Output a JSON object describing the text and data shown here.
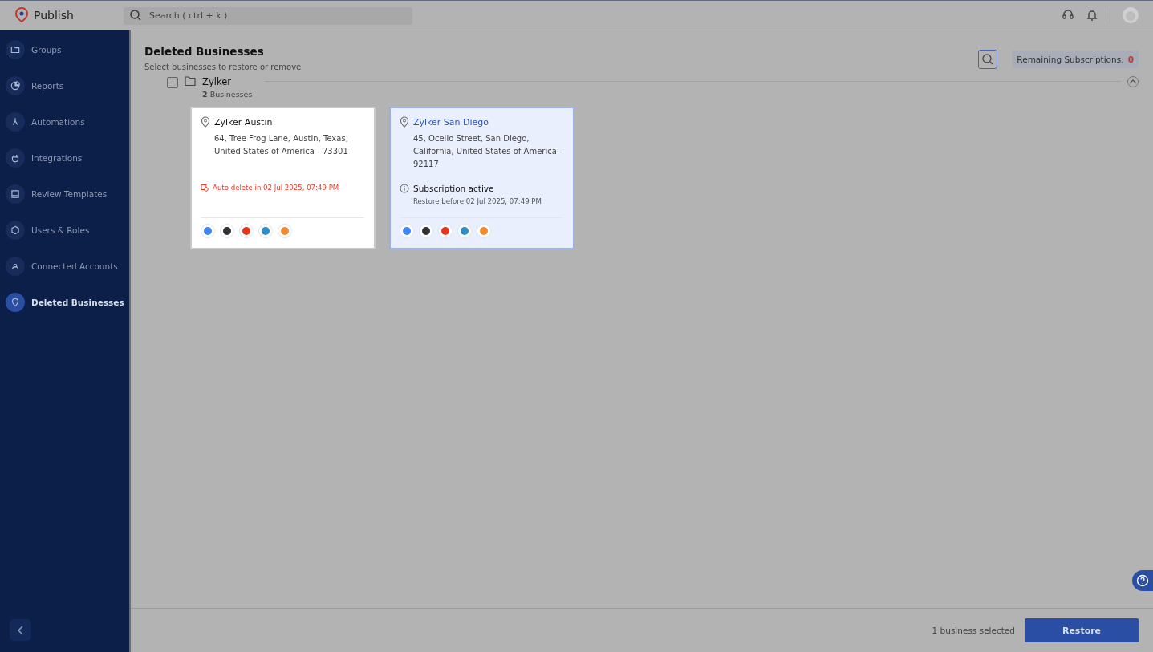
{
  "app": {
    "name": "Publish"
  },
  "search": {
    "placeholder": "Search ( ctrl + k )"
  },
  "sidebar": {
    "items": [
      {
        "label": "Groups",
        "selected": false
      },
      {
        "label": "Reports",
        "selected": false
      },
      {
        "label": "Automations",
        "selected": false
      },
      {
        "label": "Integrations",
        "selected": false
      },
      {
        "label": "Review Templates",
        "selected": false
      },
      {
        "label": "Users & Roles",
        "selected": false
      },
      {
        "label": "Connected Accounts",
        "selected": false
      },
      {
        "label": "Deleted Businesses",
        "selected": true
      }
    ]
  },
  "page": {
    "title": "Deleted Businesses",
    "subtitle": "Select businesses to restore or remove",
    "remaining_label": "Remaining Subscriptions:",
    "remaining_value": "0"
  },
  "group": {
    "name": "Zylker",
    "count": "**2** Businesses",
    "checked": false,
    "expanded": true,
    "businesses": [
      {
        "name": "Zylker Austin",
        "address": "64, Tree Frog Lane, Austin, Texas, United States of America - 73301",
        "selected": false,
        "status": {
          "kind": "auto_delete",
          "text": "Auto delete in 02 Jul 2025, 07:49 PM"
        }
      },
      {
        "name": "Zylker San Diego",
        "address": "45, Ocello Street, San Diego, California, United States of America - 92117",
        "selected": true,
        "status": {
          "kind": "subscription",
          "text": "Subscription active",
          "note": "Restore before 02 Jul 2025, 07:49 PM"
        }
      }
    ]
  },
  "footer": {
    "selection": "1 business selected",
    "button": "Restore"
  }
}
